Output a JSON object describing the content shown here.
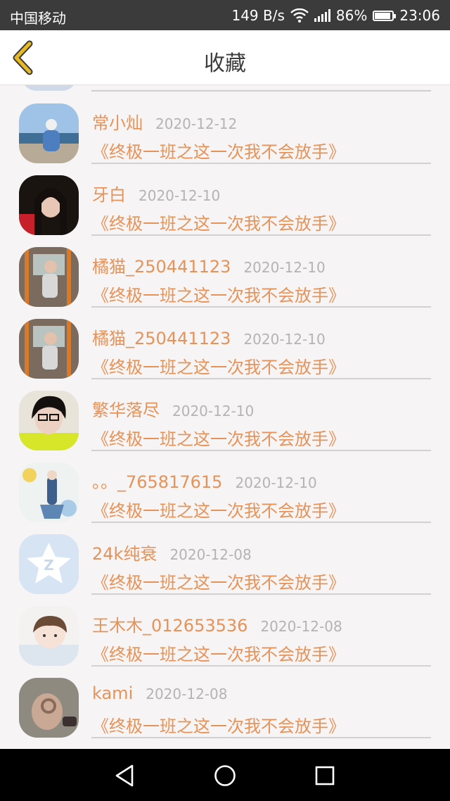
{
  "status_bar": {
    "carrier": "中国移动",
    "net_speed": "149 B/s",
    "battery": "86%",
    "time": "23:06",
    "icons": [
      "wifi-icon",
      "signal-icon",
      "battery-icon"
    ]
  },
  "header": {
    "title": "收藏",
    "back_icon": "chevron-left-icon"
  },
  "colors": {
    "accent": "#e6935a",
    "date": "#b4b4b4",
    "back_icon": "#e8b820"
  },
  "favorites": [
    {
      "name": "常小灿",
      "date": "2020-12-12",
      "title": "《终极一班之这一次我不会放手》"
    },
    {
      "name": "牙白",
      "date": "2020-12-10",
      "title": "《终极一班之这一次我不会放手》"
    },
    {
      "name": "橘猫_250441123",
      "date": "2020-12-10",
      "title": "《终极一班之这一次我不会放手》"
    },
    {
      "name": "橘猫_250441123",
      "date": "2020-12-10",
      "title": "《终极一班之这一次我不会放手》"
    },
    {
      "name": "繁华落尽",
      "date": "2020-12-10",
      "title": "《终极一班之这一次我不会放手》"
    },
    {
      "name": "。。_765817615",
      "date": "2020-12-10",
      "title": "《终极一班之这一次我不会放手》"
    },
    {
      "name": "24k纯衰",
      "date": "2020-12-08",
      "title": "《终极一班之这一次我不会放手》"
    },
    {
      "name": "王木木_012653536",
      "date": "2020-12-08",
      "title": "《终极一班之这一次我不会放手》"
    },
    {
      "name": "kami",
      "date": "2020-12-08",
      "title": "《终极一班之这一次我不会放手》"
    }
  ],
  "nav_bar": {
    "icons": [
      "back-triangle-icon",
      "home-circle-icon",
      "recents-square-icon"
    ]
  }
}
